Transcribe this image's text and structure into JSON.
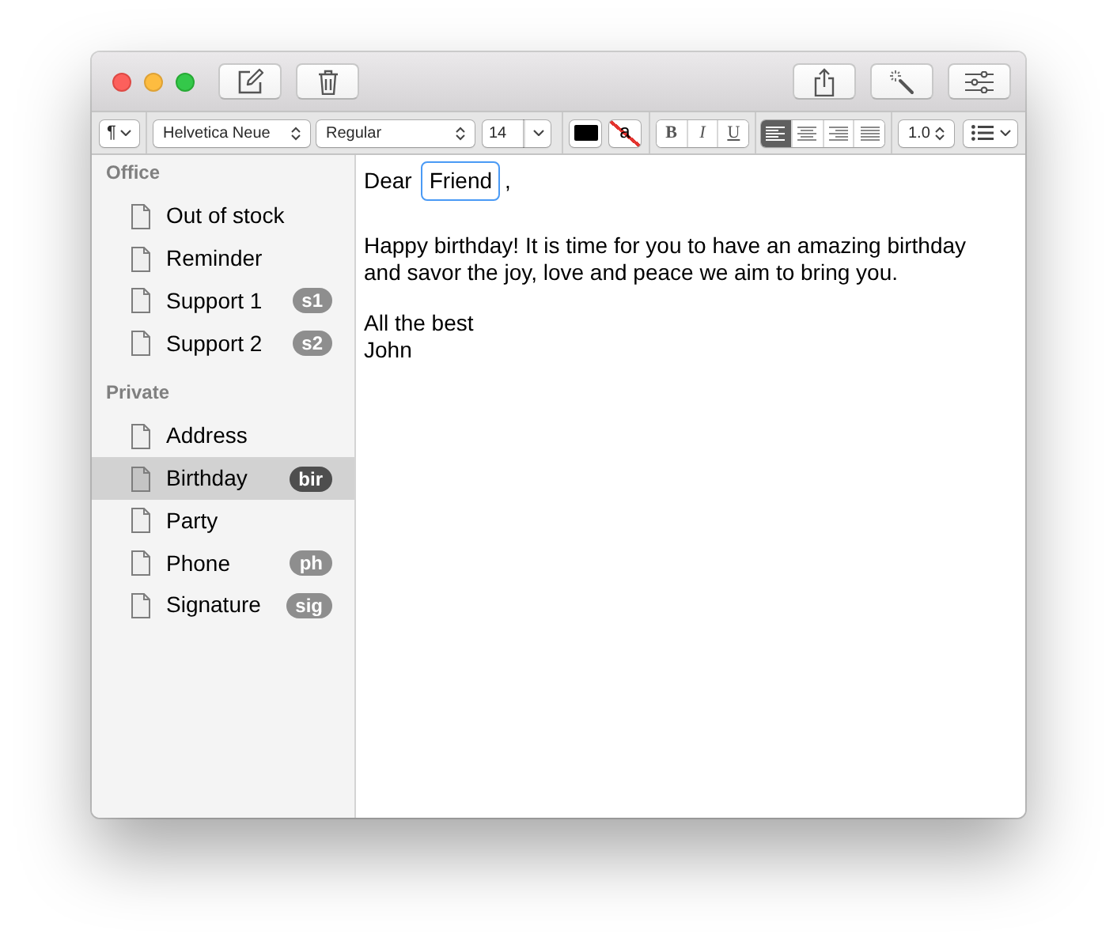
{
  "format_bar": {
    "paragraph_style": {
      "label": "¶"
    },
    "font_family": {
      "value": "Helvetica Neue"
    },
    "font_style": {
      "value": "Regular"
    },
    "font_size": {
      "value": "14"
    },
    "text_color": {
      "color": "#000000"
    },
    "highlight": {
      "label": "a"
    },
    "style_buttons": [
      {
        "kind": "bold",
        "label": "B",
        "selected": false
      },
      {
        "kind": "italic",
        "label": "I",
        "selected": false
      },
      {
        "kind": "underline",
        "label": "U",
        "selected": false
      }
    ],
    "alignment": [
      {
        "kind": "left",
        "selected": true
      },
      {
        "kind": "center",
        "selected": false
      },
      {
        "kind": "right",
        "selected": false
      },
      {
        "kind": "justify",
        "selected": false
      }
    ],
    "line_spacing": {
      "value": "1.0"
    }
  },
  "sidebar": {
    "sections": [
      {
        "title": "Office",
        "items": [
          {
            "label": "Out of stock",
            "selected": false
          },
          {
            "label": "Reminder",
            "selected": false
          },
          {
            "label": "Support 1",
            "badge": "s1",
            "selected": false
          },
          {
            "label": "Support 2",
            "badge": "s2",
            "selected": false
          }
        ]
      },
      {
        "title": "Private",
        "items": [
          {
            "label": "Address",
            "selected": false
          },
          {
            "label": "Birthday",
            "badge": "bir",
            "selected": true
          },
          {
            "label": "Party",
            "selected": false
          },
          {
            "label": "Phone",
            "badge": "ph",
            "selected": false
          },
          {
            "label": "Signature",
            "badge": "sig",
            "selected": false
          }
        ]
      }
    ]
  },
  "editor": {
    "greeting": "Dear",
    "token": "Friend",
    "greeting_end": ",",
    "paragraphs": [
      "Happy birthday! It is time for you to have an amazing birthday and savor the joy, love and peace we aim to bring you."
    ],
    "closing": [
      "All the best",
      "John"
    ]
  }
}
